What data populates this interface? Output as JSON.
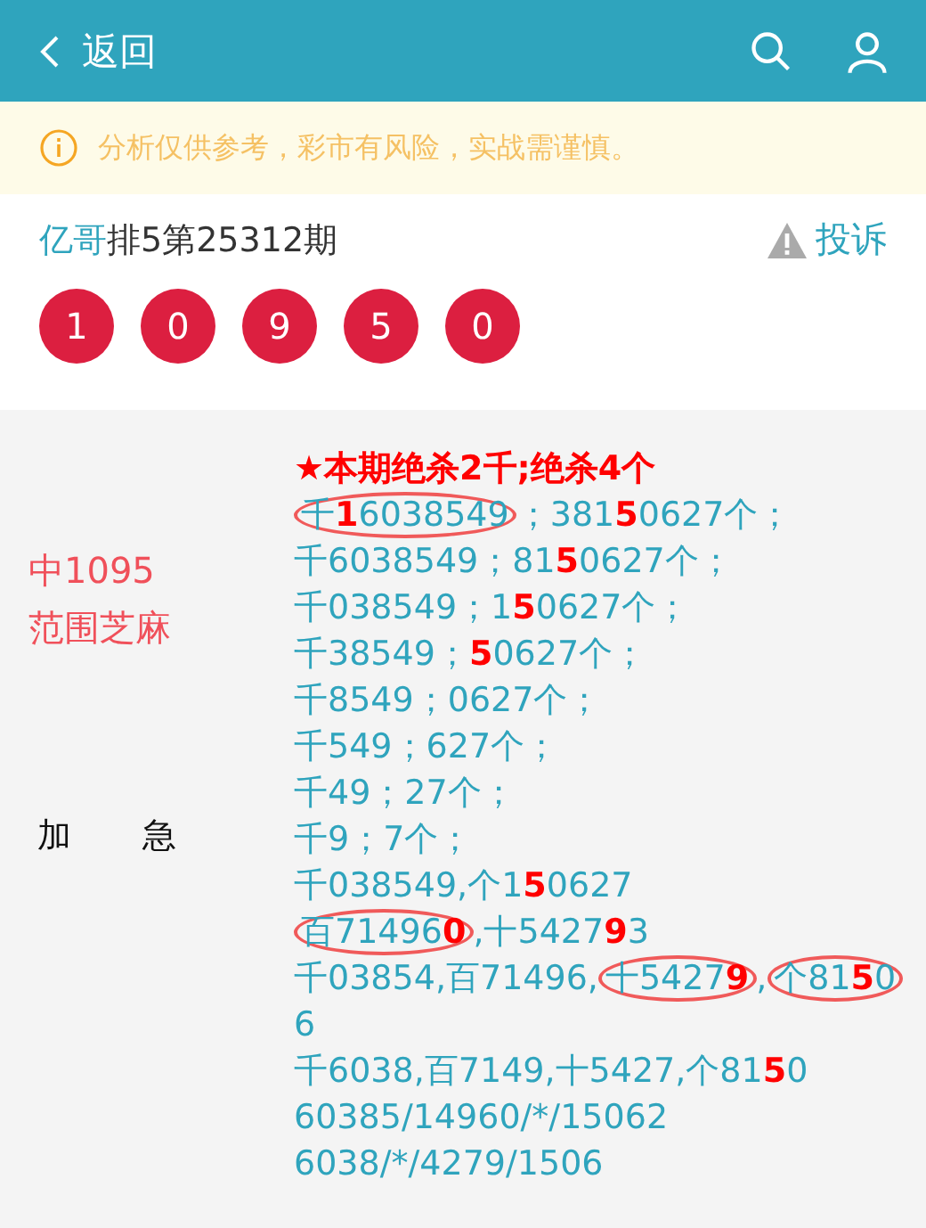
{
  "header": {
    "back_label": "返回"
  },
  "notice": {
    "text": "分析仅供参考，彩市有风险，实战需谨慎。"
  },
  "post": {
    "author": "亿哥",
    "issue": "排5第25312期",
    "complaint_label": "投诉"
  },
  "balls": [
    "1",
    "0",
    "9",
    "5",
    "0"
  ],
  "side": {
    "result_lines": [
      "中1095",
      "范围芝麻"
    ],
    "tag": [
      "加",
      "急"
    ]
  },
  "content": {
    "headline": "★本期绝杀2千;绝杀4个",
    "lines": [
      {
        "segments": [
          {
            "text": "千**1**6038549",
            "circled": true
          },
          {
            "text": "；381**5**0627个；",
            "circled": false
          }
        ]
      },
      {
        "segments": [
          {
            "text": "千6038549；81**5**0627个；",
            "circled": false
          }
        ]
      },
      {
        "segments": [
          {
            "text": "千038549；1**5**0627个；",
            "circled": false
          }
        ]
      },
      {
        "segments": [
          {
            "text": "千38549；**5**0627个；",
            "circled": false
          }
        ]
      },
      {
        "segments": [
          {
            "text": "千8549；0627个；",
            "circled": false
          }
        ]
      },
      {
        "segments": [
          {
            "text": "千549；627个；",
            "circled": false
          }
        ]
      },
      {
        "segments": [
          {
            "text": "千49；27个；",
            "circled": false
          }
        ]
      },
      {
        "segments": [
          {
            "text": "千9；7个；",
            "circled": false
          }
        ]
      },
      {
        "segments": [
          {
            "text": "千038549,个1**5**0627",
            "circled": false
          }
        ]
      },
      {
        "segments": [
          {
            "text": "百71496**0**",
            "circled": true
          },
          {
            "text": ",十5427**9**3",
            "circled": false
          }
        ]
      },
      {
        "segments": [
          {
            "text": "千03854,百71496,",
            "circled": false
          },
          {
            "text": "十5427**9**",
            "circled": true
          },
          {
            "text": ",",
            "circled": false
          },
          {
            "text": "个81**5**0",
            "circled": true
          },
          {
            "text": "6",
            "circled": false
          }
        ]
      },
      {
        "segments": [
          {
            "text": "千6038,百7149,十5427,个81**5**0",
            "circled": false
          }
        ]
      },
      {
        "segments": [
          {
            "text": "60385/14960/*/15062",
            "circled": false
          }
        ]
      },
      {
        "segments": [
          {
            "text": "6038/*/4279/1506",
            "circled": false
          }
        ]
      }
    ]
  }
}
